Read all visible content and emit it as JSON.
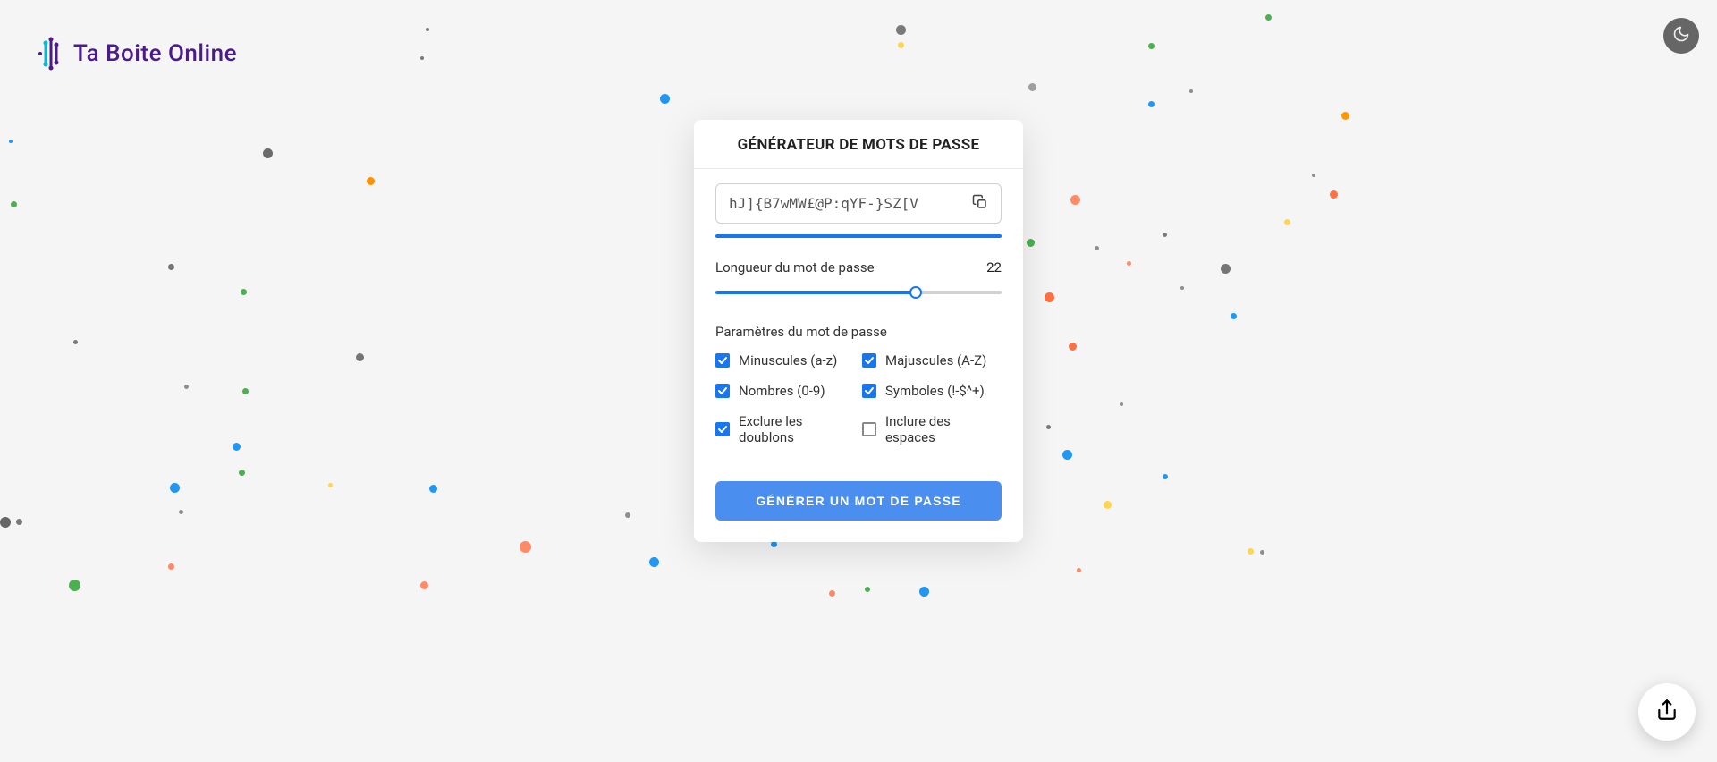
{
  "brand": {
    "name": "Ta Boite Online"
  },
  "header": {
    "title": "GÉNÉRATEUR DE MOTS DE PASSE"
  },
  "password": {
    "value": "hJ]{B7wMW£@P:qYF-}SZ[V"
  },
  "length": {
    "label": "Longueur du mot de passe",
    "value": "22",
    "percent": 70
  },
  "settings": {
    "label": "Paramètres du mot de passe"
  },
  "options": {
    "lowercase": {
      "label": "Minuscules (a-z)",
      "checked": true
    },
    "uppercase": {
      "label": "Majuscules (A-Z)",
      "checked": true
    },
    "numbers": {
      "label": "Nombres (0-9)",
      "checked": true
    },
    "symbols": {
      "label": "Symboles (!-$^+)",
      "checked": true
    },
    "exclude": {
      "label": "Exclure les doublons",
      "checked": true
    },
    "spaces": {
      "label": "Inclure des espaces",
      "checked": false
    }
  },
  "generate": {
    "label": "GÉNÉRER UN MOT DE PASSE"
  },
  "icons": {
    "copy": "copy",
    "moon": "moon",
    "share": "share"
  },
  "colors": {
    "primary": "#1976f2",
    "brand": "#4a1b8a",
    "button": "#4a8ff0"
  }
}
